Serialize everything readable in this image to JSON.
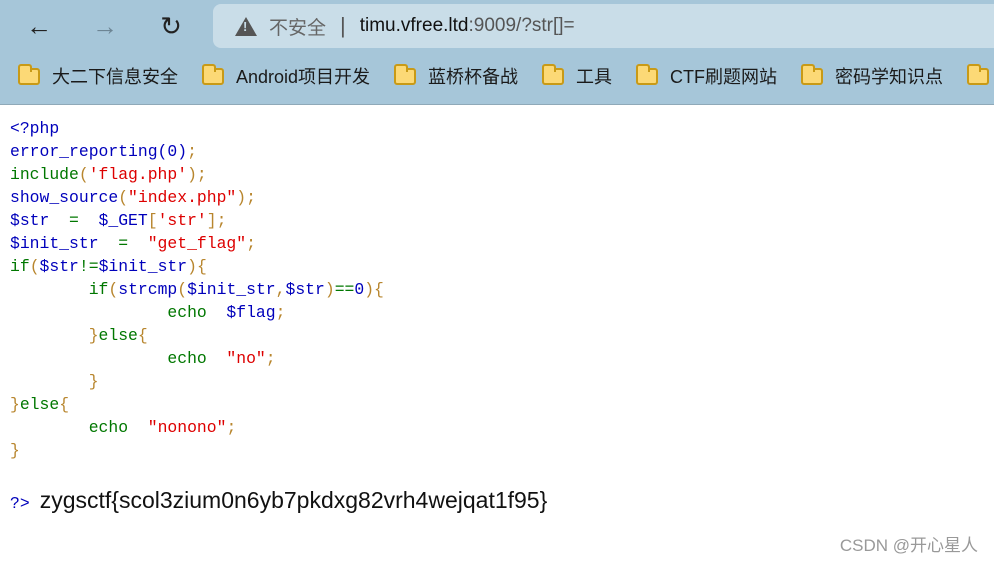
{
  "browser": {
    "back_icon": "arrow-left",
    "forward_icon": "arrow-right",
    "reload_icon": "reload",
    "security_label": "不安全",
    "url_host": "timu.vfree.ltd",
    "url_rest": ":9009/?str[]=",
    "bookmarks": [
      {
        "label": "大二下信息安全"
      },
      {
        "label": "Android项目开发"
      },
      {
        "label": "蓝桥杯备战"
      },
      {
        "label": "工具"
      },
      {
        "label": "CTF刷题网站"
      },
      {
        "label": "密码学知识点"
      }
    ]
  },
  "colors": {
    "default": "#0000BB",
    "keyword": "#007700",
    "string": "#DD0000",
    "punct": "#b8862e",
    "chrome": "#a6c6d9"
  },
  "code": {
    "lines": [
      {
        "tokens": [
          {
            "t": "<?php",
            "c": "d"
          }
        ]
      },
      {
        "tokens": [
          {
            "t": "error_reporting(0)",
            "c": "d"
          },
          {
            "t": ";",
            "c": "p"
          }
        ]
      },
      {
        "tokens": [
          {
            "t": "include",
            "c": "k"
          },
          {
            "t": "(",
            "c": "p"
          },
          {
            "t": "'flag.php'",
            "c": "s"
          },
          {
            "t": ");",
            "c": "p"
          }
        ]
      },
      {
        "tokens": [
          {
            "t": "show_source",
            "c": "d"
          },
          {
            "t": "(",
            "c": "p"
          },
          {
            "t": "\"index.php\"",
            "c": "s"
          },
          {
            "t": ");",
            "c": "p"
          }
        ]
      },
      {
        "tokens": [
          {
            "t": "$str",
            "c": "d"
          },
          {
            "t": "  =  ",
            "c": "k"
          },
          {
            "t": "$_GET",
            "c": "d"
          },
          {
            "t": "[",
            "c": "p"
          },
          {
            "t": "'str'",
            "c": "s"
          },
          {
            "t": "];",
            "c": "p"
          }
        ]
      },
      {
        "tokens": [
          {
            "t": "$init_str",
            "c": "d"
          },
          {
            "t": "  =  ",
            "c": "k"
          },
          {
            "t": "\"get_flag\"",
            "c": "s"
          },
          {
            "t": ";",
            "c": "p"
          }
        ]
      },
      {
        "tokens": [
          {
            "t": "if",
            "c": "k"
          },
          {
            "t": "(",
            "c": "p"
          },
          {
            "t": "$str",
            "c": "d"
          },
          {
            "t": "!=",
            "c": "k"
          },
          {
            "t": "$init_str",
            "c": "d"
          },
          {
            "t": "){",
            "c": "p"
          }
        ]
      },
      {
        "tokens": [
          {
            "t": "        ",
            "c": "k"
          },
          {
            "t": "if",
            "c": "k"
          },
          {
            "t": "(",
            "c": "p"
          },
          {
            "t": "strcmp",
            "c": "d"
          },
          {
            "t": "(",
            "c": "p"
          },
          {
            "t": "$init_str",
            "c": "d"
          },
          {
            "t": ",",
            "c": "p"
          },
          {
            "t": "$str",
            "c": "d"
          },
          {
            "t": ")",
            "c": "p"
          },
          {
            "t": "==",
            "c": "k"
          },
          {
            "t": "0",
            "c": "d"
          },
          {
            "t": "){",
            "c": "p"
          }
        ]
      },
      {
        "tokens": [
          {
            "t": "                ",
            "c": "k"
          },
          {
            "t": "echo  ",
            "c": "k"
          },
          {
            "t": "$flag",
            "c": "d"
          },
          {
            "t": ";",
            "c": "p"
          }
        ]
      },
      {
        "tokens": [
          {
            "t": "        ",
            "c": "k"
          },
          {
            "t": "}",
            "c": "p"
          },
          {
            "t": "else",
            "c": "k"
          },
          {
            "t": "{",
            "c": "p"
          }
        ]
      },
      {
        "tokens": [
          {
            "t": "                ",
            "c": "k"
          },
          {
            "t": "echo  ",
            "c": "k"
          },
          {
            "t": "\"no\"",
            "c": "s"
          },
          {
            "t": ";",
            "c": "p"
          }
        ]
      },
      {
        "tokens": [
          {
            "t": "        ",
            "c": "k"
          },
          {
            "t": "}",
            "c": "p"
          }
        ]
      },
      {
        "tokens": [
          {
            "t": "}",
            "c": "p"
          },
          {
            "t": "else",
            "c": "k"
          },
          {
            "t": "{",
            "c": "p"
          }
        ]
      },
      {
        "tokens": [
          {
            "t": "        ",
            "c": "k"
          },
          {
            "t": "echo  ",
            "c": "k"
          },
          {
            "t": "\"nonono\"",
            "c": "s"
          },
          {
            "t": ";",
            "c": "p"
          }
        ]
      },
      {
        "tokens": [
          {
            "t": "}",
            "c": "p"
          }
        ]
      }
    ],
    "close_tag": "?>",
    "output": "zygsctf{scol3zium0n6yb7pkdxg82vrh4wejqat1f95}"
  },
  "watermark": "CSDN @开心星人"
}
